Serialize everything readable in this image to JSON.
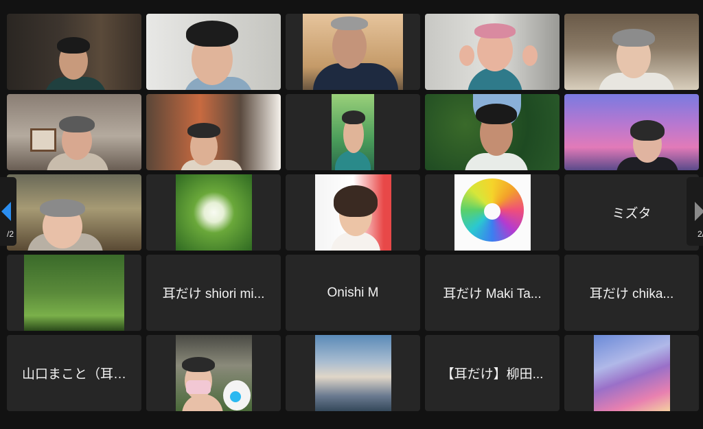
{
  "grid": {
    "name_tiles": {
      "r3c5": "ミズタ",
      "r4c2": "耳だけ shiori mi...",
      "r4c3": "Onishi M",
      "r4c4": "耳だけ  Maki Ta...",
      "r4c5": "耳だけ    chika...",
      "r5c1": "山口まこと（耳…",
      "r5c4": "【耳だけ】柳田..."
    }
  },
  "navigation": {
    "prev_page_label": "/2",
    "next_page_label": "2/",
    "prev_icon": "triangle-left-icon",
    "next_icon": "triangle-right-icon"
  },
  "colors": {
    "background": "#121212",
    "tile": "#262626",
    "accent": "#2b8ef0",
    "name_text": "#f2f2f2"
  }
}
